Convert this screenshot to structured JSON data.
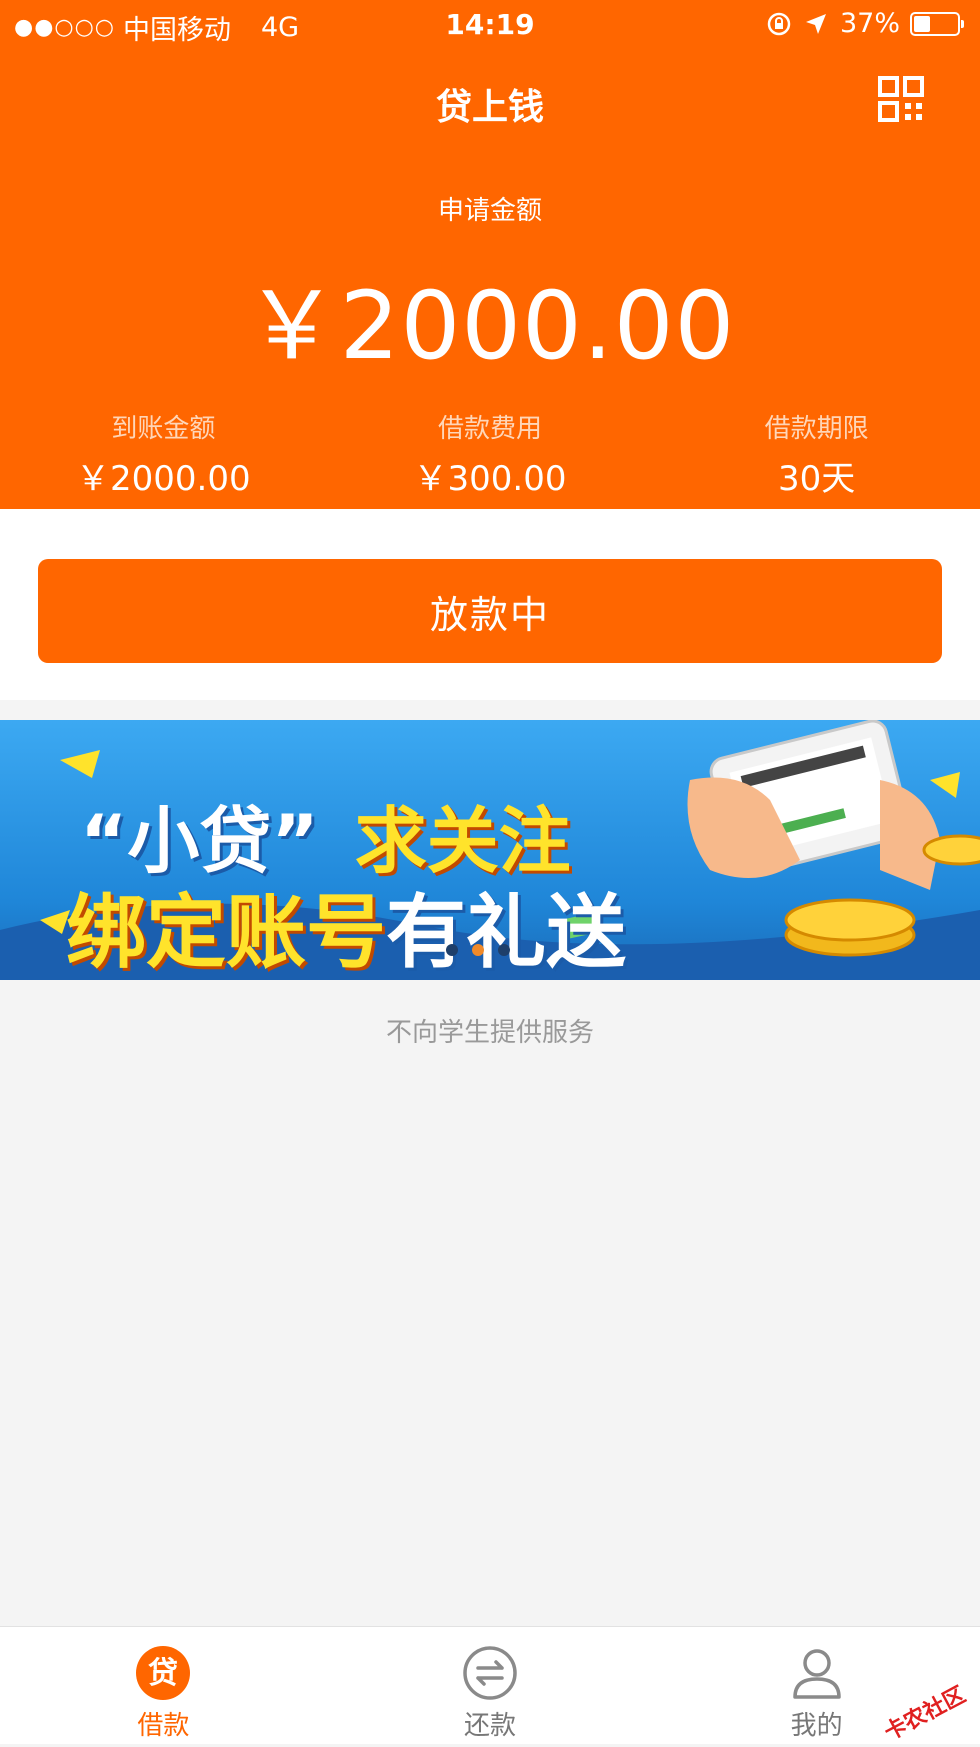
{
  "status_bar": {
    "signal": "●●○○○",
    "carrier": "中国移动",
    "network": "4G",
    "time": "14:19",
    "battery": "37%",
    "battery_level": 0.37
  },
  "nav": {
    "title": "贷上钱"
  },
  "loan": {
    "apply_label": "申请金额",
    "apply_amount": "￥2000.00",
    "summary": [
      {
        "label": "到账金额",
        "value": "￥2000.00"
      },
      {
        "label": "借款费用",
        "value": "￥300.00"
      },
      {
        "label": "借款期限",
        "value": "30天"
      }
    ]
  },
  "action": {
    "button_label": "放款中"
  },
  "banner": {
    "line1_white": "“小贷”",
    "line1_yellow": "求关注",
    "line2_yellow": "绑定账号",
    "line2_white": "有礼送"
  },
  "notice": "不向学生提供服务",
  "tabs": [
    {
      "label": "借款",
      "icon_char": "贷",
      "active": true
    },
    {
      "label": "还款",
      "active": false
    },
    {
      "label": "我的",
      "active": false
    }
  ],
  "watermark": "卡农社区",
  "colors": {
    "brand": "#ff6600",
    "background": "#f4f4f4"
  }
}
